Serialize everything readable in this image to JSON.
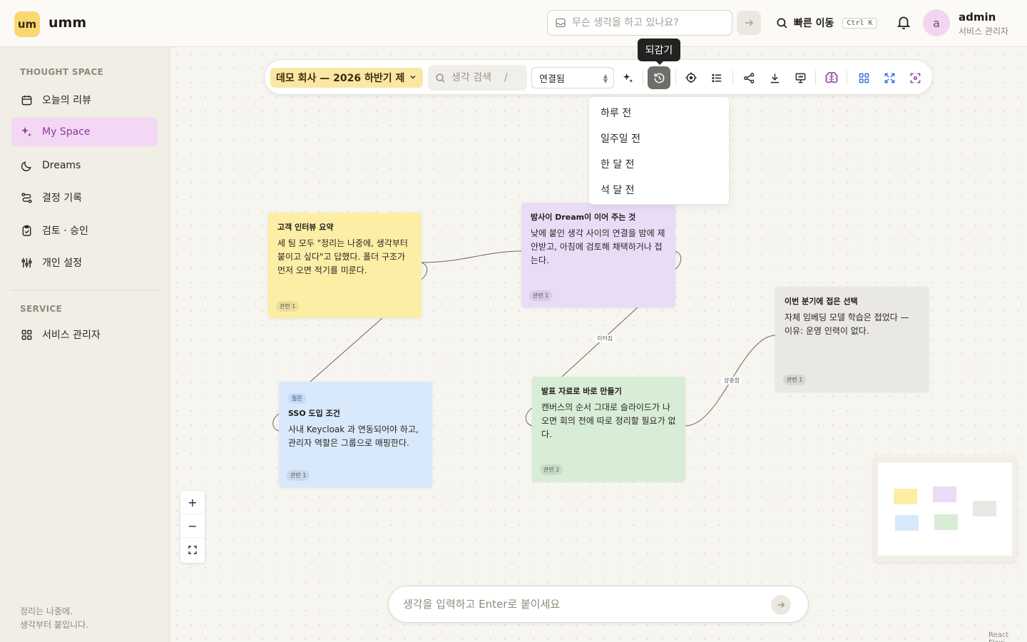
{
  "header": {
    "logo_mark": "um",
    "logo_text": "umm",
    "quick_input_placeholder": "무슨 생각을 하고 있나요?",
    "jump_label": "빠른 이동",
    "jump_shortcut": "Ctrl K",
    "user": {
      "avatar": "a",
      "name": "admin",
      "role": "서비스 관리자"
    }
  },
  "sidebar": {
    "section_thought": "THOUGHT SPACE",
    "items": [
      {
        "label": "오늘의 리뷰",
        "icon": "calendar-icon"
      },
      {
        "label": "My Space",
        "icon": "sparkle-icon",
        "active": true
      },
      {
        "label": "Dreams",
        "icon": "moon-icon"
      },
      {
        "label": "결정 기록",
        "icon": "route-icon"
      },
      {
        "label": "검토 · 승인",
        "icon": "clipboard-check-icon"
      },
      {
        "label": "개인 설정",
        "icon": "sliders-icon"
      }
    ],
    "section_service": "SERVICE",
    "service_items": [
      {
        "label": "서비스 관리자",
        "icon": "grid-icon"
      }
    ],
    "footer_line1": "정리는 나중에.",
    "footer_line2": "생각부터 붙입니다."
  },
  "toolbar": {
    "space_name": "데모 회사 — 2026 하반기 제",
    "search_placeholder": "생각 검색",
    "search_shortcut": "/",
    "mode_value": "연결됨",
    "tooltip": "되감기",
    "rewind_options": [
      "하루 전",
      "일주일 전",
      "한 달 전",
      "석 달 전"
    ]
  },
  "nodes": [
    {
      "id": "interview",
      "title": "고객 인터뷰 요약",
      "body": "세 팀 모두 \"정리는 나중에, 생각부터 붙이고 싶다\"고 답했다. 폴더 구조가 먼저 오면 적기를 미룬다.",
      "rel": "관련 1",
      "color": "yellow"
    },
    {
      "id": "dream",
      "title": "밤사이 Dream이 이어 주는 것",
      "body": "낮에 붙인 생각 사이의 연결을 밤에 제안받고, 아침에 검토해 채택하거나 접는다.",
      "rel": "관련 1",
      "color": "purple"
    },
    {
      "id": "sso",
      "tag": "질문",
      "title": "SSO 도입 조건",
      "body": "사내 Keycloak 과 연동되어야 하고, 관리자 역할은 그룹으로 매핑한다.",
      "rel": "관련 1",
      "color": "blue"
    },
    {
      "id": "slides",
      "title": "발표 자료로 바로 만들기",
      "body": "캔버스의 순서 그대로 슬라이드가 나오면 회의 전에 따로 정리할 필요가 없다.",
      "rel": "관련 2",
      "color": "green"
    },
    {
      "id": "quarter",
      "title": "이번 분기에 접은 선택",
      "body": "자체 임베딩 모델 학습은 접었다 — 이유: 운영 인력이 없다.",
      "rel": "관련 1",
      "color": "gray"
    }
  ],
  "edge_labels": {
    "dream_slides": "이어짐",
    "slides_quarter": "상충함"
  },
  "compose_placeholder": "생각을 입력하고 Enter로 붙이세요",
  "attribution": "React Flow"
}
